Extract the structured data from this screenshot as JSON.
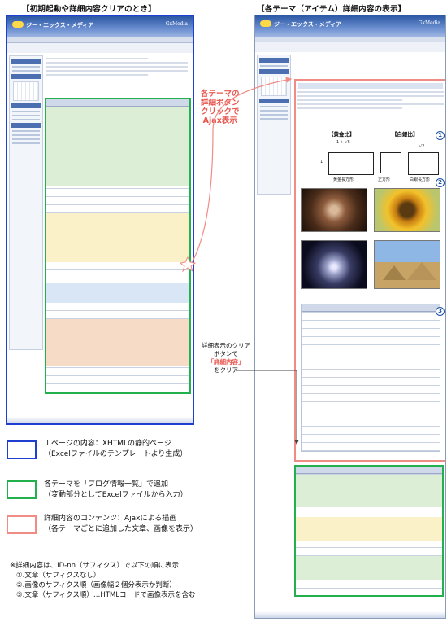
{
  "titles": {
    "left": "【初期起動や詳細内容クリアのとき】",
    "right": "【各テーマ（アイテム）詳細内容の表示】"
  },
  "callouts": {
    "ajax": [
      "各テーマの",
      "詳細ボタン",
      "クリックで",
      "Ajax表示"
    ],
    "clear": [
      "詳細表示のクリア",
      "ボタンで",
      "「詳細内容」",
      "をクリア"
    ]
  },
  "colors": {
    "blue": "#1f3fd0",
    "green": "#22b14c",
    "red": "#f08c84"
  },
  "legend": [
    {
      "color": "blue",
      "lines": [
        "１ページの内容：XHTMLの静的ページ",
        "（Excelファイルのテンプレートより生成）"
      ]
    },
    {
      "color": "green",
      "lines": [
        "各テーマを「ブログ情報一覧」で追加",
        "（変動部分としてExcelファイルから入力）"
      ]
    },
    {
      "color": "red",
      "lines": [
        "詳細内容のコンテンツ：Ajaxによる描画",
        "（各テーマごとに追加した文章、画像を表示）"
      ]
    }
  ],
  "notes": [
    "※詳細内容は、ID-nn（サフィクス）で以下の順に表示",
    "①.文章（サフィクスなし）",
    "②.画像のサフィクス順（画像幅２個分表示か判断）",
    "③.文章（サフィクス順）…HTMLコードで画像表示を含む"
  ],
  "detail": {
    "label_gold": "【黄金比】",
    "label_silver": "【白銀比】",
    "formula_gold": "1 + √5",
    "formula_gold_den": "2",
    "formula_silver": "√2",
    "cap_gold": "黄金長方形",
    "cap_square": "正方形",
    "cap_silver": "白銀長方形",
    "one": "1"
  },
  "markers": [
    "1",
    "2",
    "3"
  ],
  "screenshot": {
    "logo": "ジー・エックス・メディア",
    "logo_right": "GxMedia"
  }
}
